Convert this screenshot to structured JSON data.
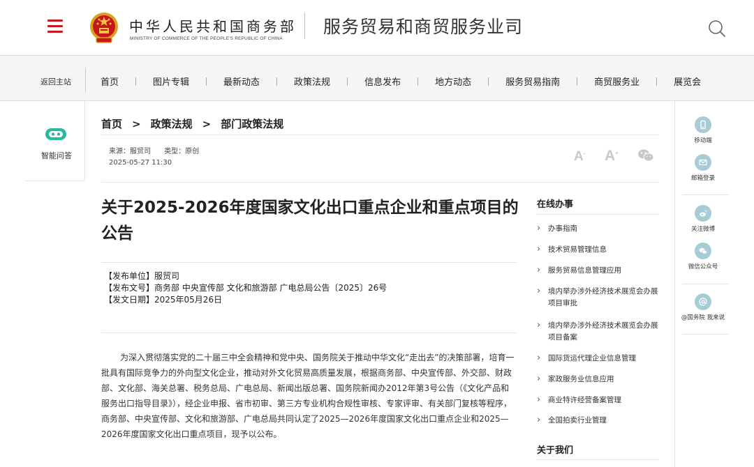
{
  "header": {
    "org_name_cn": "中华人民共和国商务部",
    "org_name_en": "MINISTRY OF COMMERCE OF THE PEOPLE'S REPUBLIC OF CHINA",
    "site_title": "服务贸易和商贸服务业司",
    "icons": {
      "menu": "hamburger-menu-icon",
      "emblem": "national-emblem-icon",
      "search": "search-icon"
    },
    "brand_color": "#c8161d"
  },
  "nav": {
    "home_link": "返回主站",
    "items": [
      {
        "label": "首页"
      },
      {
        "label": "图片专辑"
      },
      {
        "label": "最新动态"
      },
      {
        "label": "政策法规"
      },
      {
        "label": "信息发布"
      },
      {
        "label": "地方动态"
      },
      {
        "label": "服务贸易指南"
      },
      {
        "label": "商贸服务业"
      },
      {
        "label": "展览会"
      }
    ]
  },
  "left_bar": {
    "label": "智能问答",
    "icon": "robot-assistant-icon",
    "icon_color": "#2bb8a3"
  },
  "right_bar": {
    "icon_color": "#a8ccd6",
    "items": [
      {
        "label": "移动端",
        "icon": "mobile-icon"
      },
      {
        "label": "邮箱登录",
        "icon": "mail-icon"
      },
      {
        "label": "关注微博",
        "icon": "weibo-icon"
      },
      {
        "label": "微信公众号",
        "icon": "wechat-icon"
      },
      {
        "label": "@国务院 我来说",
        "icon": "at-sign-icon"
      }
    ]
  },
  "breadcrumb": {
    "items": [
      "首页",
      "政策法规",
      "部门政策法规"
    ],
    "separator": ">"
  },
  "meta": {
    "source": "来源：服贸司",
    "type": "类型：原创",
    "date": "2025-05-27 11:30",
    "font_larger": "A",
    "font_smaller": "A",
    "font_larger_sup": "+",
    "font_smaller_sup": "-",
    "share_icon": "wechat-share-icon"
  },
  "article": {
    "title": "关于2025-2026年度国家文化出口重点企业和重点项目的公告",
    "publisher": "【发布单位】服贸司",
    "doc_number": "【发布文号】商务部 中央宣传部 文化和旅游部 广电总局公告〔2025〕26号",
    "publish_date": "【发文日期】2025年05月26日",
    "body": "为深入贯彻落实党的二十届三中全会精神和党中央、国务院关于推动中华文化“走出去”的决策部署，培育一批具有国际竞争力的外向型文化企业，推动对外文化贸易高质量发展，根据商务部、中央宣传部、外交部、财政部、文化部、海关总署、税务总局、广电总局、新闻出版总署、国务院新闻办2012年第3号公告（《文化产品和服务出口指导目录》），经企业申报、省市初审、第三方专业机构合规性审核、专家评审、有关部门复核等程序，商务部、中央宣传部、文化和旅游部、广电总局共同认定了2025—2026年度国家文化出口重点企业和2025—2026年度国家文化出口重点项目，现予以公布。"
  },
  "sidebar": {
    "title": "在线办事",
    "items": [
      {
        "label": "办事指南"
      },
      {
        "label": "技术贸易管理信息"
      },
      {
        "label": "服务贸易信息管理应用"
      },
      {
        "label": "境内举办涉外经济技术展览会办展项目审批"
      },
      {
        "label": "境内举办涉外经济技术展览会办展项目备案"
      },
      {
        "label": "国际货运代理企业信息管理"
      },
      {
        "label": "家政服务业信息应用"
      },
      {
        "label": "商业特许经营备案管理"
      },
      {
        "label": "全国拍卖行业管理"
      }
    ],
    "title2": "关于我们"
  }
}
